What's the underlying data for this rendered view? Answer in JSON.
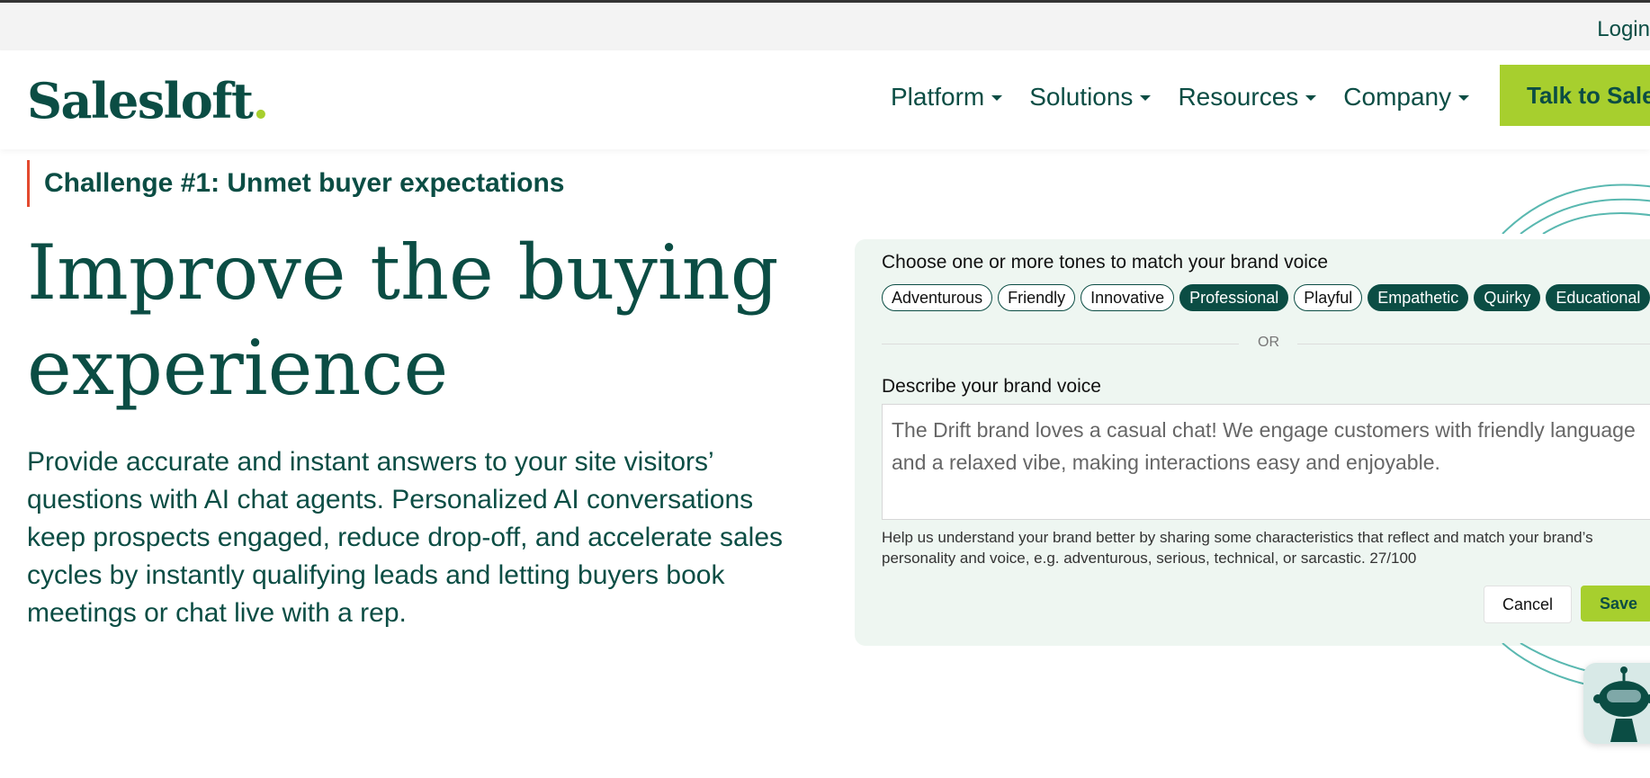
{
  "topbar": {
    "login_label": "Login"
  },
  "nav": {
    "logo_text": "Salesloft",
    "logo_dot": ".",
    "items": [
      "Platform",
      "Solutions",
      "Resources",
      "Company"
    ],
    "cta_label": "Talk to Sales"
  },
  "hero": {
    "eyebrow": "Challenge #1: Unmet buyer expectations",
    "title": "Improve the buying experience",
    "body": "Provide accurate and instant answers to your site visitors’ questions with AI chat agents. Personalized AI conversations keep prospects engaged, reduce drop-off, and accelerate sales cycles by instantly qualifying leads and letting buyers book meetings or chat live with a rep."
  },
  "panel": {
    "tones_label": "Choose one or more tones to match your brand voice",
    "tones": [
      {
        "label": "Adventurous",
        "selected": false
      },
      {
        "label": "Friendly",
        "selected": false
      },
      {
        "label": "Innovative",
        "selected": false
      },
      {
        "label": "Professional",
        "selected": true
      },
      {
        "label": "Playful",
        "selected": false
      },
      {
        "label": "Empathetic",
        "selected": true
      },
      {
        "label": "Quirky",
        "selected": true
      },
      {
        "label": "Educational",
        "selected": true
      }
    ],
    "or_text": "OR",
    "describe_label": "Describe your brand voice",
    "describe_value": "The Drift brand loves a casual chat! We engage customers with friendly language and a relaxed vibe, making interactions easy and enjoyable.",
    "help_text": "Help us understand your brand better by sharing some characteristics that reflect and match your brand’s personality and voice, e.g. adventurous, serious, technical, or sarcastic. 27/100",
    "cancel_label": "Cancel",
    "save_label": "Save"
  },
  "colors": {
    "brand_dark": "#0b4d44",
    "brand_lime": "#a7cf2e",
    "eyebrow_accent": "#e34a2f",
    "panel_bg": "#eef6f1"
  }
}
